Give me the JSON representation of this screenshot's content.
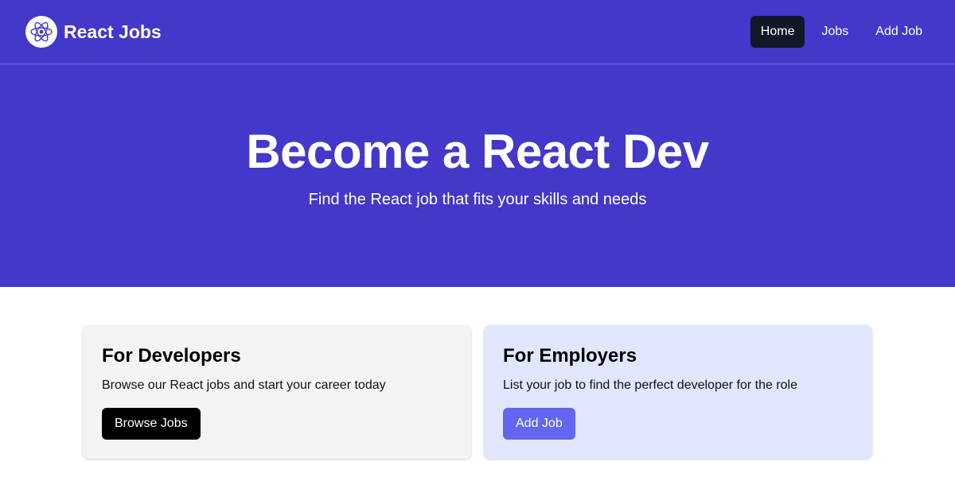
{
  "navbar": {
    "brand_name": "React Jobs",
    "logo_icon": "react-atom-icon",
    "links": [
      {
        "label": "Home",
        "active": true
      },
      {
        "label": "Jobs",
        "active": false
      },
      {
        "label": "Add Job",
        "active": false
      }
    ]
  },
  "hero": {
    "title": "Become a React Dev",
    "subtitle": "Find the React job that fits your skills and needs"
  },
  "cards": {
    "developers": {
      "title": "For Developers",
      "text": "Browse our React jobs and start your career today",
      "button_label": "Browse Jobs"
    },
    "employers": {
      "title": "For Employers",
      "text": "List your job to find the perfect developer for the role",
      "button_label": "Add Job"
    }
  },
  "colors": {
    "brand_indigo": "#4338ca",
    "active_nav": "#111827",
    "developers_card_bg": "#f3f4f6",
    "employers_card_bg": "#e0e7ff",
    "add_job_button": "#6366f1"
  }
}
